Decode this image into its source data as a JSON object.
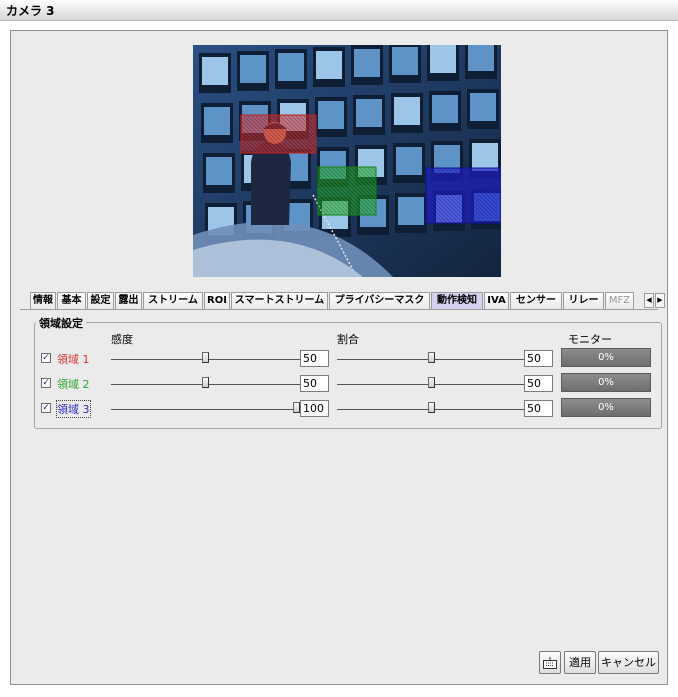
{
  "window": {
    "title": "カメラ 3"
  },
  "tabs": [
    {
      "label": "情報"
    },
    {
      "label": "基本"
    },
    {
      "label": "設定"
    },
    {
      "label": "露出"
    },
    {
      "label": "ストリーム"
    },
    {
      "label": "ROI"
    },
    {
      "label": "スマートストリーム"
    },
    {
      "label": "プライバシーマスク"
    },
    {
      "label": "動作検知",
      "active": true
    },
    {
      "label": "IVA"
    },
    {
      "label": "センサー"
    },
    {
      "label": "リレー"
    },
    {
      "label": "MFZ",
      "disabled": true
    }
  ],
  "tab_scroll": {
    "left_icon": "arrow-left-icon",
    "right_icon": "arrow-right-icon"
  },
  "region_settings": {
    "legend": "領域設定",
    "col_sensitivity": "感度",
    "col_ratio": "割合",
    "col_monitor": "モニター",
    "regions": [
      {
        "label": "領域 1",
        "checked": true,
        "color": "#e53030",
        "sensitivity": 50,
        "sensitivity_text": "50",
        "ratio": 50,
        "ratio_text": "50",
        "monitor": "0%"
      },
      {
        "label": "領域 2",
        "checked": true,
        "color": "#2aa52a",
        "sensitivity": 50,
        "sensitivity_text": "50",
        "ratio": 50,
        "ratio_text": "50",
        "monitor": "0%"
      },
      {
        "label": "領域 3",
        "checked": true,
        "color": "#2c2ccc",
        "sensitivity": 100,
        "sensitivity_text": "100",
        "ratio": 50,
        "ratio_text": "50",
        "monitor": "0%"
      }
    ]
  },
  "buttons": {
    "keyboard_icon": "keyboard-icon",
    "apply": "適用",
    "cancel": "キャンセル"
  },
  "preview": {
    "region_overlays": [
      {
        "name": "region-1-overlay",
        "color": "#e03030"
      },
      {
        "name": "region-2-overlay",
        "color": "#22b022"
      },
      {
        "name": "region-3-overlay",
        "color": "#2020d8"
      }
    ]
  }
}
